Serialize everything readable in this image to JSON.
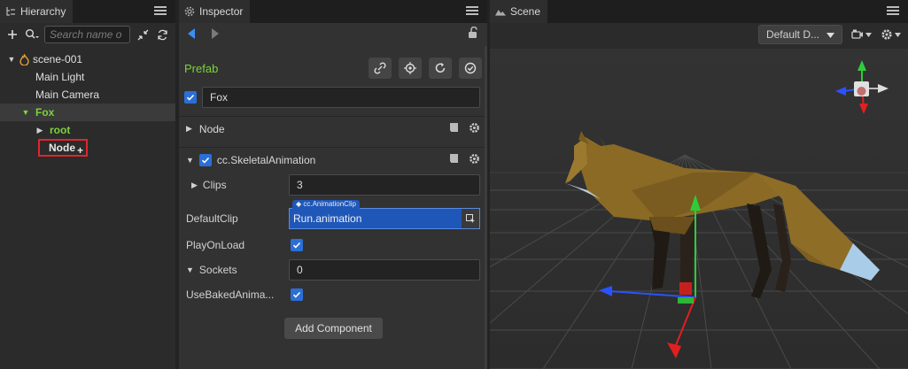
{
  "hierarchy": {
    "tab_title": "Hierarchy",
    "search_placeholder": "Search name o",
    "items": [
      {
        "label": "scene-001"
      },
      {
        "label": "Main Light"
      },
      {
        "label": "Main Camera"
      },
      {
        "label": "Fox"
      },
      {
        "label": "root"
      },
      {
        "label": "Node"
      }
    ],
    "drop_indicator": "+"
  },
  "inspector": {
    "tab_title": "Inspector",
    "prefab_label": "Prefab",
    "node_name": "Fox",
    "node_section": "Node",
    "component_section": "cc.SkeletalAnimation",
    "props": {
      "clips_label": "Clips",
      "clips_value": "3",
      "defaultclip_label": "DefaultClip",
      "defaultclip_type": "cc.AnimationClip",
      "defaultclip_value": "Run.animation",
      "playonload_label": "PlayOnLoad",
      "sockets_label": "Sockets",
      "sockets_value": "0",
      "usebaked_label": "UseBakedAnima..."
    },
    "add_component": "Add Component"
  },
  "scene": {
    "tab_title": "Scene",
    "camera_dropdown": "Default D..."
  },
  "colors": {
    "accent_blue": "#2b6fd6",
    "prefab_green": "#7bd33a",
    "highlight_red": "#e0262a"
  }
}
